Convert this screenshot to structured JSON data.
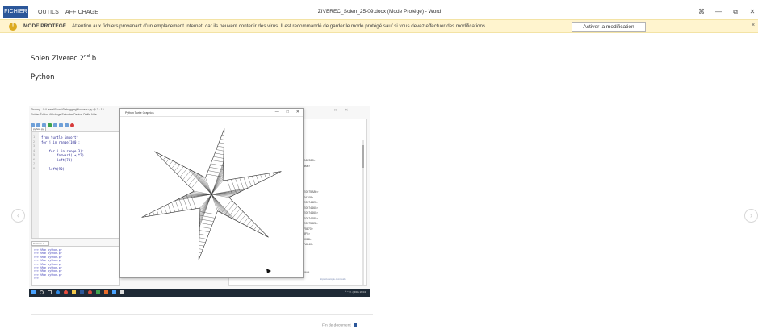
{
  "titlebar": {
    "tabs": [
      "FICHIER",
      "OUTILS",
      "AFFICHAGE"
    ],
    "doc_title": "ZIVEREC_Solen_25-09.docx (Mode Protégé) - Word",
    "controls": [
      "⌘",
      "—",
      "⧉",
      "✕"
    ]
  },
  "protected_bar": {
    "heading": "MODE PROTÉGÉ",
    "message": "Attention aux fichiers provenant d’un emplacement Internet, car ils peuvent contenir des virus. Il est recommandé de garder le mode protégé sauf si vous devez effectuer des modifications.",
    "button": "Activer la modification",
    "close": "×"
  },
  "document": {
    "author_name": "Solen Ziverec  2",
    "author_sup": "nd",
    "author_tail": " b",
    "subject": "Python",
    "end_of_document": "Fin de document"
  },
  "screenshot": {
    "thonny_title": "Thonny - C:\\Users\\Bruno\\Debugging\\Nouveau.py @ 7 : 13",
    "thonny_menu": "Fichier  Édition  Affichage  Exécuter  Device  Outils  Aide",
    "editor_tab": "python.py",
    "line_numbers": "1\n2\n3\n4\n5\n6\n7\n8",
    "code": "from turtle import*\nfor j in range(100):\n\n    for i in range(3):\n        forward(i+j*2)\n        left(70)\n\n    left(90)",
    "console_tab": "Console ×",
    "console_lines": ">>> %Run python.py\n>>> %Run python.py\n>>> %Run python.py\n>>> %Run python.py\n>>> %Run python.py\n>>> %Run python.py\n>>> %Run python.py\n>>> %Run python.py\n>>>",
    "right_lines": "D6E580>\nass'>\n\n\n\n\nE0075A80>\n7A208>\nE0074420>\nE0074460>\nE0074460>\nE0074480>\nE0075828>\n75870>\n8F0>\n0088>\n7A540>",
    "status_text": "ec.ac bug prerequisites interaction bugs in general debugging techniques",
    "status_link": "https://example.com/guide",
    "turtle_title": "Python Turtle Graphics",
    "turtle_ctrls": [
      "—",
      "□",
      "✕"
    ],
    "outer_ctrls": [
      "—",
      "□",
      "✕"
    ],
    "tray": "ᴬ ^ ✉ ◁ FRA  16:04"
  },
  "colors": {
    "file_tab": "#2b579a",
    "message_bar": "#fff4ce",
    "shield": "#dcaa1f",
    "taskbar": "#1f2a36"
  }
}
